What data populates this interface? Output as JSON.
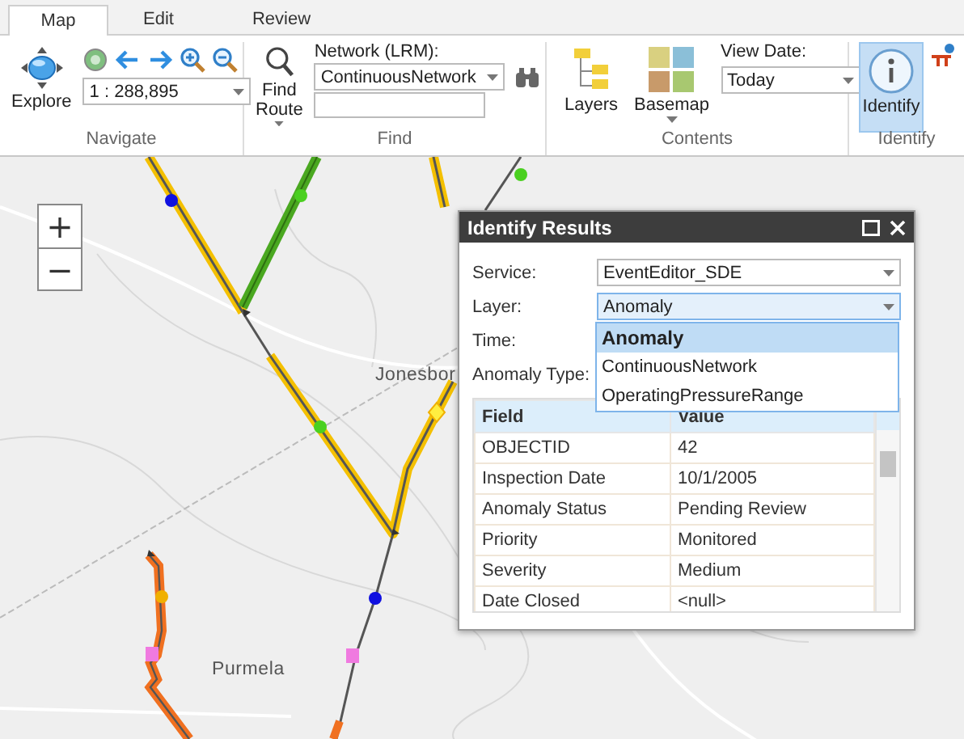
{
  "tabs": [
    {
      "label": "Map",
      "selected": true
    },
    {
      "label": "Edit",
      "selected": false
    },
    {
      "label": "Review",
      "selected": false
    }
  ],
  "navigate": {
    "label": "Navigate",
    "explore_button": "Explore",
    "scale": "1 : 288,895"
  },
  "find": {
    "label": "Find",
    "find_route_button": "Find Route",
    "network_label": "Network (LRM):",
    "network_value": "ContinuousNetwork"
  },
  "contents": {
    "label": "Contents",
    "layers_button": "Layers",
    "basemap_button": "Basemap",
    "view_date_label": "View Date:",
    "view_date_value": "Today"
  },
  "identify": {
    "label": "Identify",
    "identify_button": {
      "label": "Identify",
      "selected": true
    }
  },
  "map": {
    "place_labels": [
      {
        "text": "Jonesbor"
      },
      {
        "text": "Purmela"
      }
    ],
    "zoom_in": "+",
    "zoom_out": "−"
  },
  "identify_results": {
    "title": "Identify Results",
    "fields": [
      {
        "label": "Service:",
        "value": "EventEditor_SDE"
      },
      {
        "label": "Layer:",
        "value": "Anomaly"
      },
      {
        "label": "Time:"
      },
      {
        "label": "Anomaly Type:"
      }
    ],
    "layer_options": [
      {
        "label": "Anomaly",
        "selected": true
      },
      {
        "label": "ContinuousNetwork",
        "selected": false
      },
      {
        "label": "OperatingPressureRange",
        "selected": false
      }
    ],
    "columns": [
      "Field",
      "Value"
    ],
    "rows": [
      [
        "OBJECTID",
        "42"
      ],
      [
        "Inspection Date",
        "10/1/2005"
      ],
      [
        "Anomaly Status",
        "Pending Review"
      ],
      [
        "Priority",
        "Monitored"
      ],
      [
        "Severity",
        "Medium"
      ],
      [
        "Date Closed",
        "<null>"
      ]
    ]
  }
}
